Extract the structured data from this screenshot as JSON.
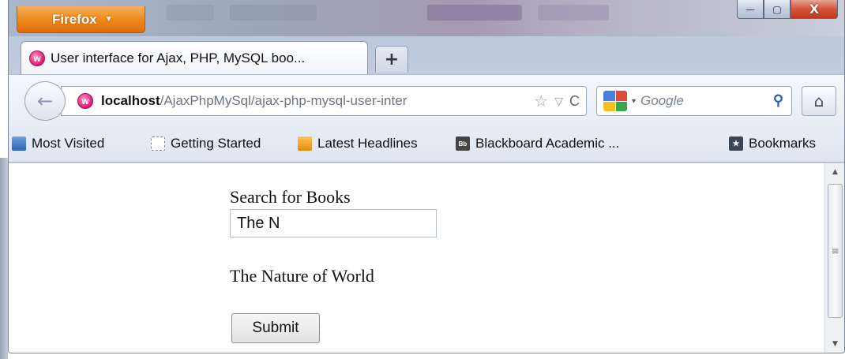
{
  "window": {
    "menu_button_label": "Firefox",
    "menu_arrow": "▼",
    "controls": {
      "minimize": "—",
      "maximize": "▢",
      "close": "X"
    }
  },
  "tabs": [
    {
      "title": "User interface for Ajax, PHP, MySQL boo...",
      "icon": "wamp-page-icon",
      "active": true
    }
  ],
  "new_tab_label": "+",
  "navigation": {
    "back_icon": "←",
    "url_host": "localhost",
    "url_path": "/AjaxPhpMySql/ajax-php-mysql-user-inter",
    "bookmark_star": "☆",
    "history_dropdown": "▽",
    "reload_icon": "C",
    "search_engine_dropdown": "▾",
    "search_placeholder": "Google",
    "search_icon": "⚲",
    "home_icon": "⌂"
  },
  "bookmarks": [
    {
      "label": "Most Visited",
      "icon": "most-visited-icon"
    },
    {
      "label": "Getting Started",
      "icon": "getting-started-icon"
    },
    {
      "label": "Latest Headlines",
      "icon": "rss-icon"
    },
    {
      "label": "Blackboard Academic ...",
      "icon": "blackboard-icon",
      "icon_text": "Bb"
    },
    {
      "label": "Bookmarks",
      "icon": "bookmarks-star-icon",
      "icon_text": "★"
    }
  ],
  "page": {
    "search_label": "Search for Books",
    "search_value": "The N",
    "result_text": "The Nature of World",
    "submit_label": "Submit"
  },
  "scrollbar": {
    "up": "▲",
    "down": "▼",
    "grip": "≡"
  },
  "colors": {
    "firefox_orange": "#ec8a1c",
    "close_red": "#d5533a",
    "page_background": "#ffffff"
  }
}
